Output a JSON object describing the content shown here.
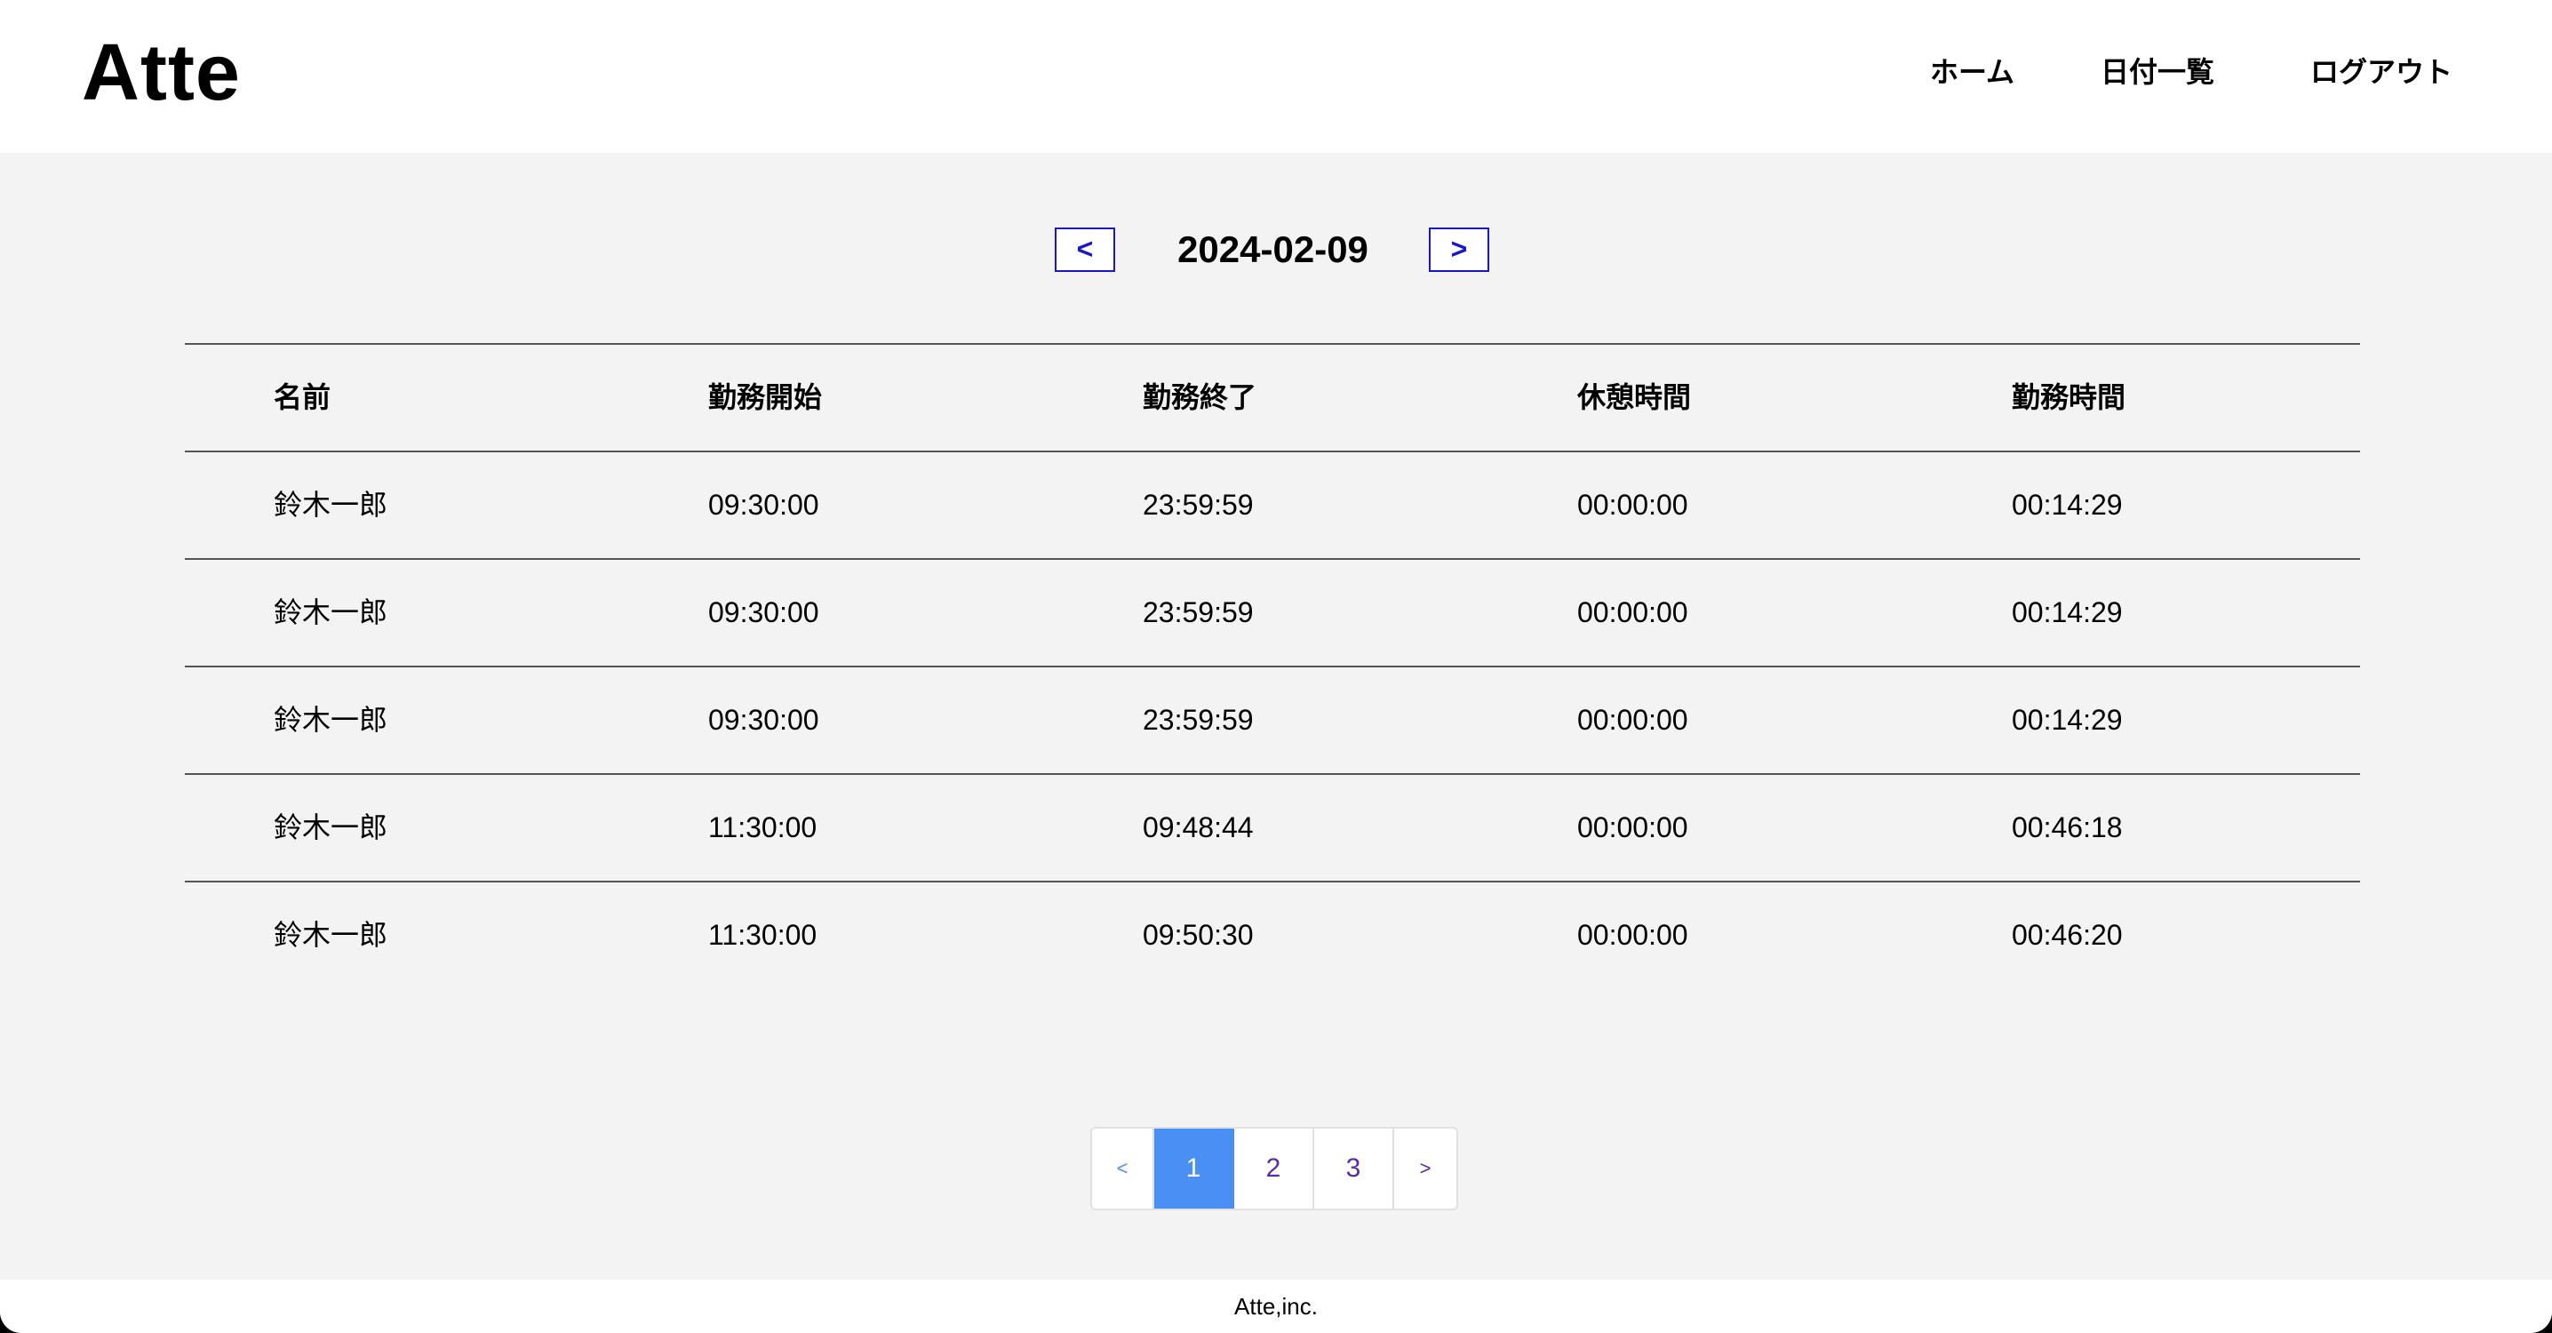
{
  "app": {
    "logo": "Atte"
  },
  "nav": {
    "home": "ホーム",
    "date_list": "日付一覧",
    "logout": "ログアウト"
  },
  "date_nav": {
    "prev": "<",
    "date": "2024-02-09",
    "next": ">"
  },
  "table": {
    "headers": [
      "名前",
      "勤務開始",
      "勤務終了",
      "休憩時間",
      "勤務時間"
    ],
    "rows": [
      [
        "鈴木一郎",
        "09:30:00",
        "23:59:59",
        "00:00:00",
        "00:14:29"
      ],
      [
        "鈴木一郎",
        "09:30:00",
        "23:59:59",
        "00:00:00",
        "00:14:29"
      ],
      [
        "鈴木一郎",
        "09:30:00",
        "23:59:59",
        "00:00:00",
        "00:14:29"
      ],
      [
        "鈴木一郎",
        "11:30:00",
        "09:48:44",
        "00:00:00",
        "00:46:18"
      ],
      [
        "鈴木一郎",
        "11:30:00",
        "09:50:30",
        "00:00:00",
        "00:46:20"
      ]
    ]
  },
  "pagination": {
    "prev": "<",
    "pages": [
      "1",
      "2",
      "3"
    ],
    "active": "1",
    "next": ">"
  },
  "footer": {
    "text": "Atte,inc."
  },
  "colors": {
    "accent_blue": "#1a17c9",
    "active_page": "#4a8ff3",
    "background": "#f3f3f3"
  }
}
